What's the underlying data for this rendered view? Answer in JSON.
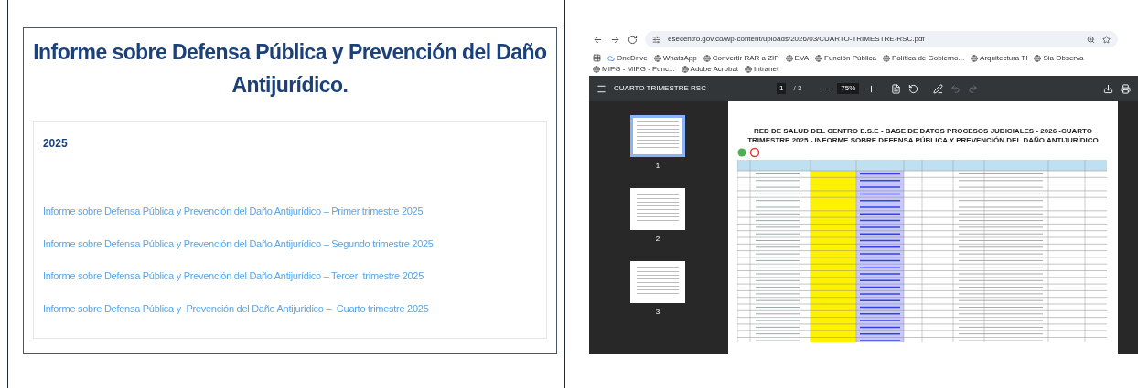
{
  "report_panel": {
    "title": "Informe sobre Defensa Pública y Prevención del Daño Antijurídico.",
    "section": {
      "heading": "2025",
      "links": [
        "Informe sobre Defensa Pública y Prevención del Daño Antijurídico – Primer trimestre 2025",
        "Informe sobre Defensa Pública y Prevención del Daño Antijurídico – Segundo trimestre 2025",
        "Informe sobre Defensa Pública y Prevención del Daño Antijurídico – Tercer  trimestre 2025",
        "Informe sobre Defensa Pública y  Prevención del Daño Antijurídico –  Cuarto trimestre 2025"
      ]
    }
  },
  "browser": {
    "url": "esecentro.gov.co/wp-content/uploads/2026/03/CUARTO-TRIMESTRE-RSC.pdf",
    "bookmarks": [
      "OneDrive",
      "WhatsApp",
      "Convertir RAR a ZIP",
      "EVA",
      "Función Pública",
      "Política de Gobierno...",
      "Arquitectura TI",
      "Sia Observa",
      "MIPG - MIPG - Func...",
      "Adobe Acrobat",
      "Intranet"
    ],
    "pdf_viewer": {
      "document_title": "CUARTO TRIMESTRE RSC",
      "page_number": "1",
      "page_count": "/ 3",
      "zoom": "75%",
      "thumbnails": [
        {
          "label": "1",
          "selected": true
        },
        {
          "label": "2",
          "selected": false
        },
        {
          "label": "3",
          "selected": false
        }
      ],
      "page": {
        "heading": "RED DE SALUD DEL CENTRO E.S.E - BASE DE DATOS PROCESOS JUDICIALES - 2026 -CUARTO TRIMESTRE 2025 - INFORME SOBRE DEFENSA PÚBLICA Y PREVENCIÓN DEL DAÑO ANTIJURÍDICO"
      }
    }
  }
}
